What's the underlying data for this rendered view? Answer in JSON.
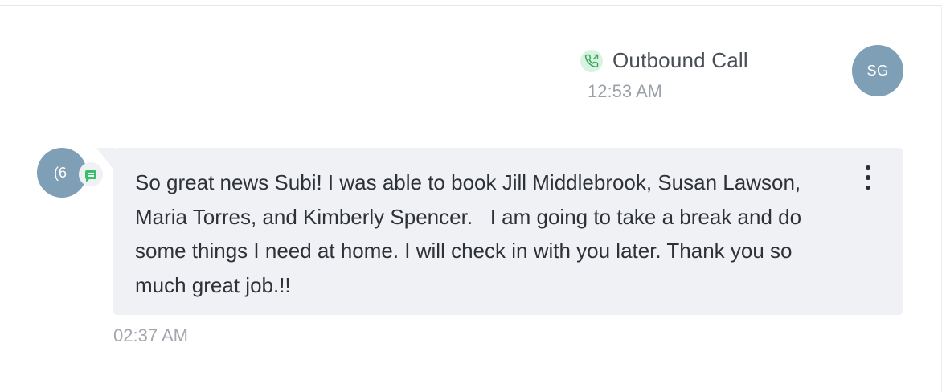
{
  "call_event": {
    "label": "Outbound Call",
    "time": "12:53 AM",
    "icon": "outbound-call-icon",
    "icon_color": "#36a85a",
    "icon_bg": "#d9f2e1"
  },
  "agent_avatar": {
    "initials": "SG",
    "color": "#7f9fb6"
  },
  "contact_avatar": {
    "initials": "(6",
    "color": "#7f9fb6"
  },
  "message": {
    "channel_icon": "sms-icon",
    "text": "So great news Subi! I was able to book Jill Middlebrook, Susan Lawson, Maria Torres, and Kimberly Spencer.   I am going to take a break and do some things I need at home. I will check in with you later. Thank you so much great job.!!",
    "time": "02:37 AM",
    "bubble_color": "#f0f1f5"
  }
}
